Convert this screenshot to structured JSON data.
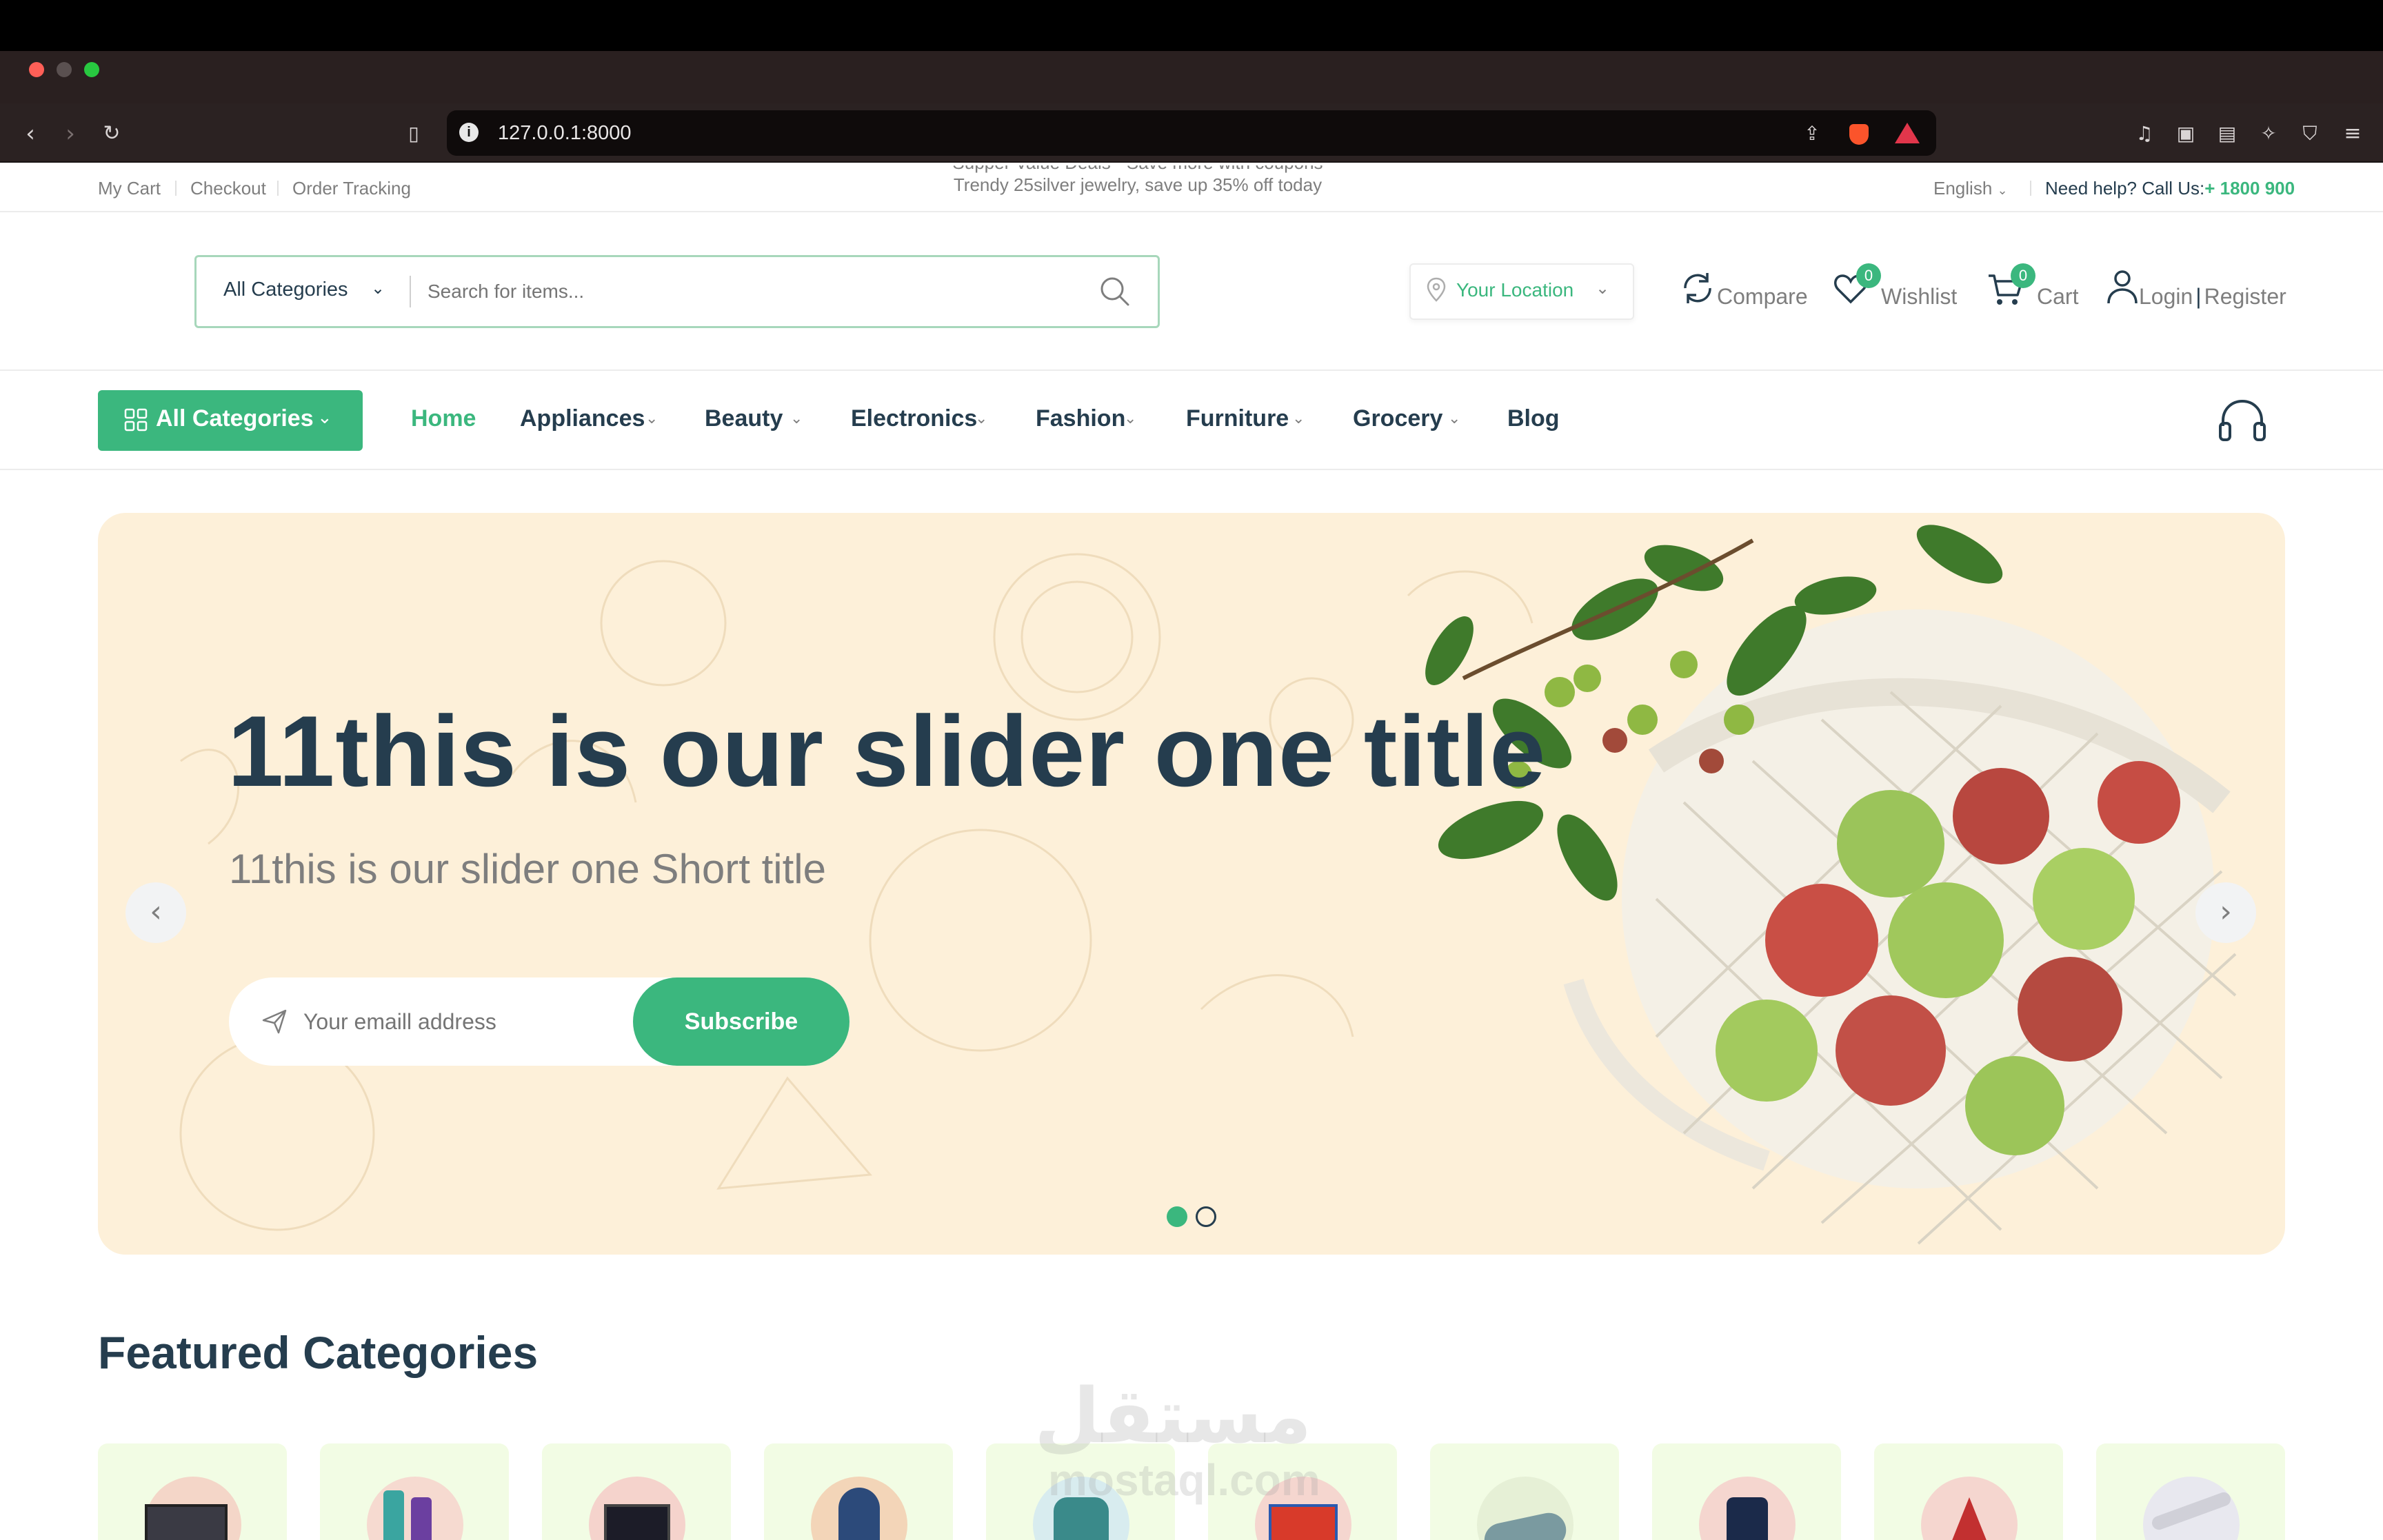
{
  "browser": {
    "url": "127.0.0.1:8000"
  },
  "topbar": {
    "links": [
      "My Cart",
      "Checkout",
      "Order Tracking"
    ],
    "ticker": [
      "Supper Value Deals - Save more with coupons",
      "Trendy 25silver jewelry, save up 35% off today"
    ],
    "language": "English",
    "help_label": "Need help? Call Us:",
    "help_phone": "+ 1800 900"
  },
  "header": {
    "search_category": "All Categories",
    "search_placeholder": "Search for items...",
    "location": "Your Location",
    "compare": "Compare",
    "wishlist": "Wishlist",
    "wishlist_count": "0",
    "cart": "Cart",
    "cart_count": "0",
    "login": "Login",
    "register": "Register"
  },
  "nav": {
    "all_categories": "All Categories",
    "items": [
      "Home",
      "Appliances",
      "Beauty",
      "Electronics",
      "Fashion",
      "Furniture",
      "Grocery",
      "Blog"
    ]
  },
  "hero": {
    "title": "11this is our slider one title",
    "subtitle": "11this is our slider one Short title",
    "email_placeholder": "Your emaill address",
    "subscribe": "Subscribe"
  },
  "featured": {
    "title": "Featured Categories"
  },
  "watermark": {
    "arabic": "مستقل",
    "latin": "mostaql.com"
  },
  "colors": {
    "brand": "#3bb77e",
    "heading": "#253d4e",
    "hero_bg": "#fdf0d9",
    "card_bg": "#f2fce4"
  }
}
